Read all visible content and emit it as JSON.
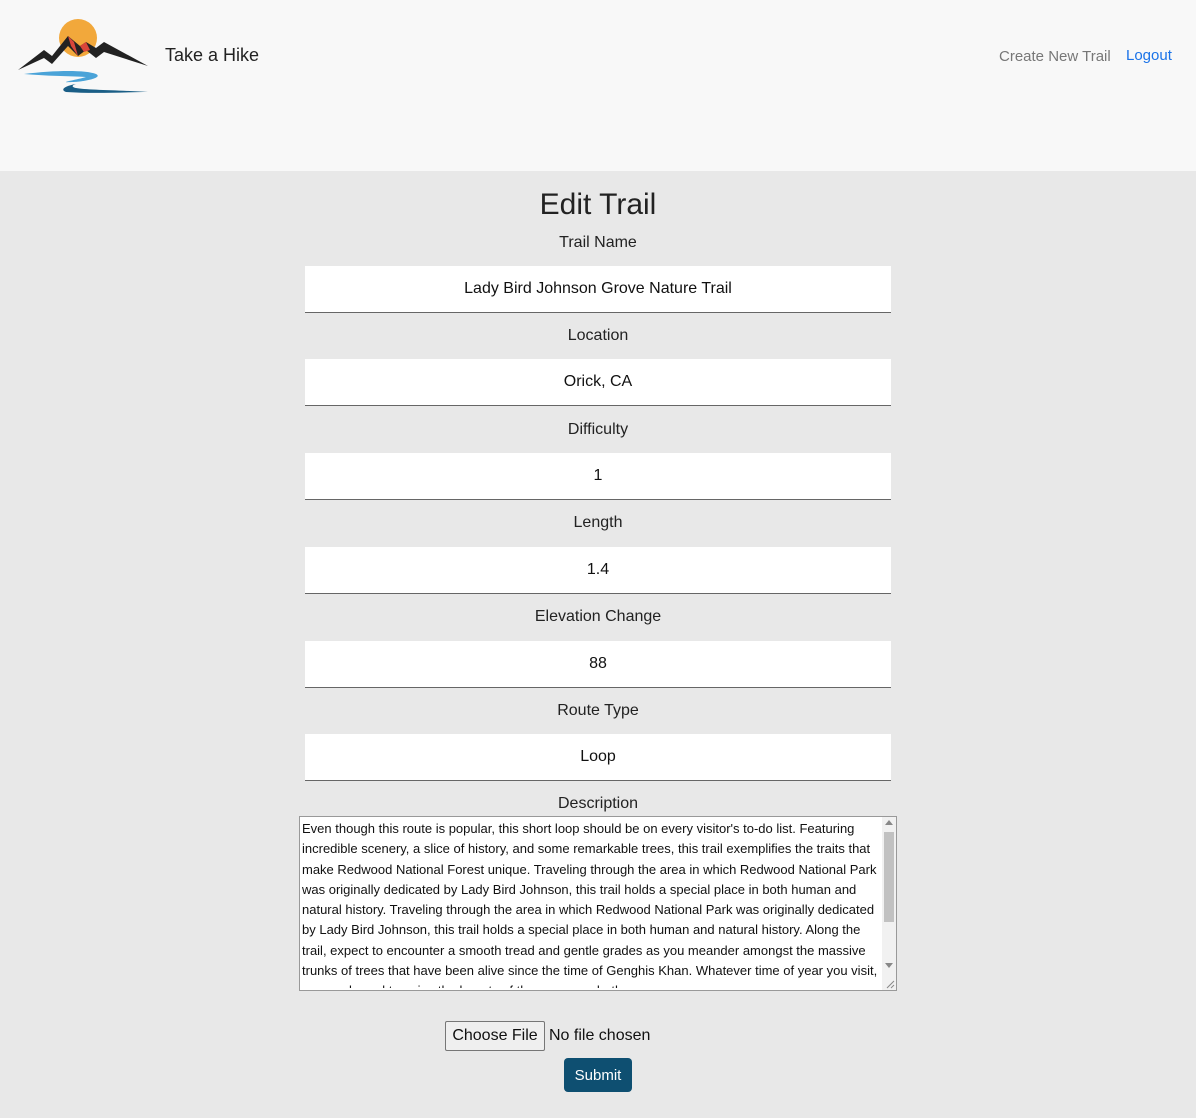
{
  "header": {
    "brand": "Take a Hike",
    "nav_create": "Create New Trail",
    "nav_logout": "Logout"
  },
  "form": {
    "title": "Edit Trail",
    "fields": [
      {
        "label": "Trail Name",
        "value": "Lady Bird Johnson Grove Nature Trail"
      },
      {
        "label": "Location",
        "value": "Orick, CA"
      },
      {
        "label": "Difficulty",
        "value": "1"
      },
      {
        "label": "Length",
        "value": "1.4"
      },
      {
        "label": "Elevation Change",
        "value": "88"
      },
      {
        "label": "Route Type",
        "value": "Loop"
      }
    ],
    "description_label": "Description",
    "description": "Even though this route is popular, this short loop should be on every visitor's to-do list. Featuring incredible scenery, a slice of history, and some remarkable trees, this trail exemplifies the traits that make Redwood National Forest unique. Traveling through the area in which Redwood National Park was originally dedicated by Lady Bird Johnson, this trail holds a special place in both human and natural history. Traveling through the area in which Redwood National Park was originally dedicated by Lady Bird Johnson, this trail holds a special place in both human and natural history. Along the trail, expect to encounter a smooth tread and gentle grades as you meander amongst the massive trunks of trees that have been alive since the time of Genghis Khan. Whatever time of year you visit, you are bound to enjoy the bounty of the season, whether",
    "file_button": "Choose File",
    "file_status": "No file chosen",
    "submit_label": "Submit"
  },
  "colors": {
    "header_bg": "#f8f8f8",
    "page_bg": "#e8e8e8",
    "link": "#1a73e8",
    "submit_bg": "#0e4f71"
  }
}
